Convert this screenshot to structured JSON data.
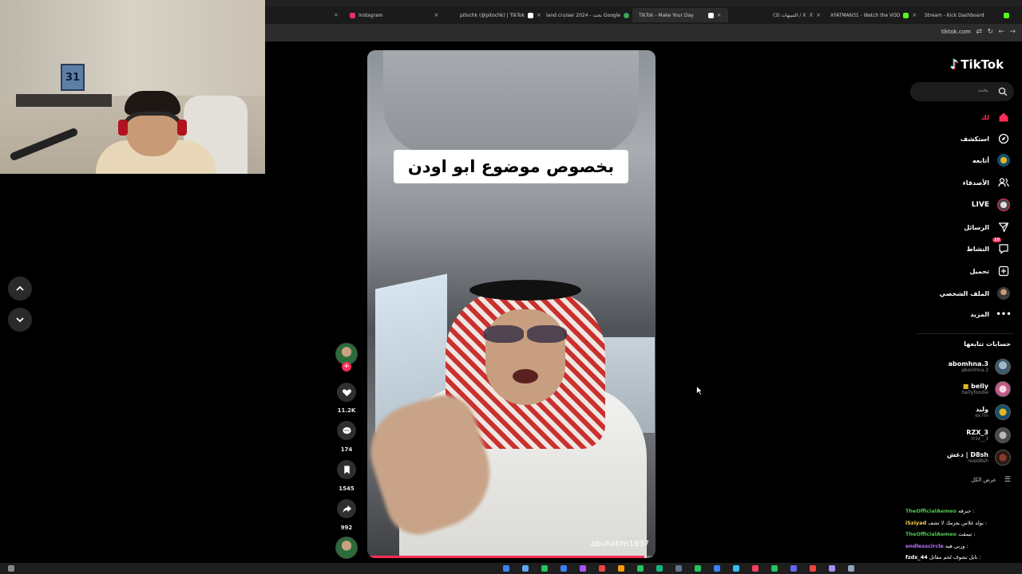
{
  "browser": {
    "tabs": [
      {
        "label": "Instagram",
        "color": "#e1306c",
        "active": false
      },
      {
        "label": "pitochk (@pitochk) | TikTok",
        "color": "#ffffff",
        "active": false
      },
      {
        "label": "land cruiser 2024 - بحث Google",
        "color": "#34a853",
        "active": false
      },
      {
        "label": "TikTok - Make Your Day",
        "color": "#ffffff",
        "active": true
      },
      {
        "label": "(3) التنبيهات / X",
        "color": "#ffffff",
        "active": false
      },
      {
        "label": "XFATMAN31 - Watch the VOD",
        "color": "#53fc18",
        "active": false
      },
      {
        "label": "Stream - Kick Dashboard",
        "color": "#53fc18",
        "active": false
      }
    ],
    "url": "tiktok.com"
  },
  "webcam": {
    "poster_number": "31"
  },
  "video": {
    "caption": "بخصوص موضوع ابو اودن",
    "username": "abuhatim1937",
    "progress": 0.96
  },
  "actions": {
    "likes": "11.2K",
    "comments": "174",
    "saves": "1545",
    "shares": "992"
  },
  "sidebar": {
    "logo": "TikTok",
    "search_placeholder": "بحث",
    "menu": [
      {
        "label": "لك",
        "icon": "home-icon",
        "color": "#fe2c55"
      },
      {
        "label": "استكشف",
        "icon": "compass-icon"
      },
      {
        "label": "أتابعه",
        "icon": "following-avatar-icon"
      },
      {
        "label": "الأصدقاء",
        "icon": "friends-icon"
      },
      {
        "label": "LIVE",
        "icon": "live-icon"
      },
      {
        "label": "الرسائل",
        "icon": "send-icon"
      },
      {
        "label": "النشاط",
        "icon": "activity-icon",
        "badge": "10"
      },
      {
        "label": "تحميل",
        "icon": "upload-icon"
      },
      {
        "label": "الملف الشخصي",
        "icon": "profile-avatar-icon"
      },
      {
        "label": "المزيد",
        "icon": "more-icon"
      }
    ],
    "following_title": "حسابات تتابعها",
    "following": [
      {
        "name": "abomhna.3",
        "handle": "abomhna.3"
      },
      {
        "name": "belly",
        "handle": "bellyfoodie"
      },
      {
        "name": "وليد",
        "handle": "ex7m"
      },
      {
        "name": "RZX_3",
        "handle": "rrzx__3"
      },
      {
        "name": "دغش | D8sh",
        "handle": "reald8sh"
      }
    ],
    "see_all": "عرض الكل"
  },
  "chat": [
    {
      "user": "TheOfficialAemeo",
      "user_color": "#4ec74e",
      "msg": "حبرقه :"
    },
    {
      "user": "iSziyad",
      "user_color": "#ffd34d",
      "msg": "بولد غلاس يعزمك لا تشف :"
    },
    {
      "user": "TheOfficialAemeo",
      "user_color": "#4ec74e",
      "msg": "تيمقت :"
    },
    {
      "user": "endlesscircle",
      "user_color": "#b872ff",
      "msg": "وربي هيه :"
    },
    {
      "user": "fzdx_44",
      "user_color": "#ffffff",
      "msg": "تابل تشوف لحم مقاتل :"
    }
  ]
}
